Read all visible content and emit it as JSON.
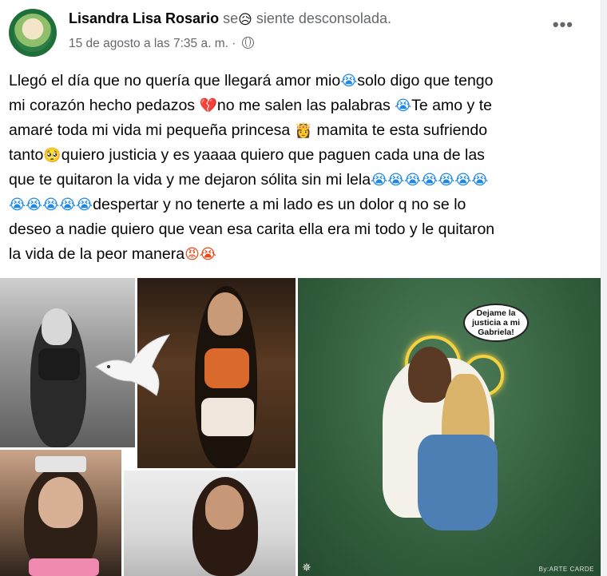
{
  "post": {
    "author": "Lisandra Lisa Rosario",
    "feeling_prefix": "se",
    "feeling_emoji": "😥",
    "feeling_text": "siente desconsolada.",
    "timestamp": "15 de agosto a las 7:35 a. m. ·",
    "privacy_icon": "globe-icon",
    "more_label": "•••",
    "body_lines": [
      {
        "text": "Llegó el día que no quería que llegará amor mio",
        "emoji_after": "😭",
        "tail": "solo digo que tengo"
      },
      {
        "text": "mi corazón hecho pedazos ",
        "emoji_after": "💔",
        "tail": "no me salen las palabras "
      },
      {
        "text": "amaré toda mi vida mi pequeña princesa ",
        "emoji_after": "👸",
        "tail": " mamita te esta sufriendo"
      },
      {
        "text": "tanto",
        "emoji_after": "🥺",
        "tail": "quiero justicia y es yaaaa quiero que paguen cada una de las"
      },
      {
        "text": "que te quitaron la vida y me dejaron sólita sin mi lela",
        "emoji_after": "😭😭😭😭😭😭😭",
        "tail": ""
      },
      {
        "text": "",
        "emoji_after": "😭😭😭😭😭",
        "tail": "despertar y no tenerte a mi lado es un dolor q no se lo"
      },
      {
        "text": "deseo a nadie quiero que vean esa carita ella era mi todo y le quitaron",
        "emoji_after": "",
        "tail": ""
      },
      {
        "text": "la vida de la peor manera",
        "emoji_after": "😡😭",
        "tail": ""
      }
    ],
    "line2_extra": {
      "emoji": "😭",
      "text": "Te amo y te"
    }
  },
  "images": {
    "speech_bubble": "Dejame la justicia a mi Gabriela!",
    "credit": "By:ARTE CARDE"
  },
  "colors": {
    "background": "#f0f2f5",
    "card": "#ffffff",
    "secondary_text": "#65676b",
    "primary_text": "#050505"
  }
}
